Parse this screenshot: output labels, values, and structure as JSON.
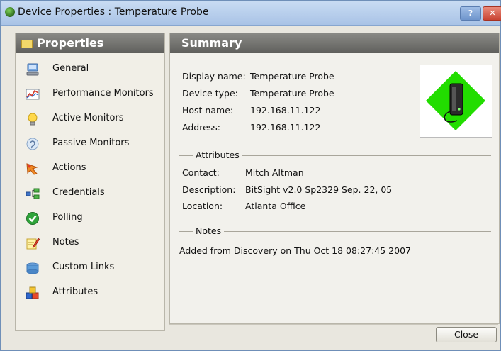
{
  "window": {
    "title": "Device Properties : Temperature Probe",
    "help_label": "?",
    "close_label": "✕"
  },
  "left_panel": {
    "header": "Properties",
    "items": [
      {
        "label": "General",
        "icon": "computer-icon"
      },
      {
        "label": "Performance Monitors",
        "icon": "chart-icon"
      },
      {
        "label": "Active Monitors",
        "icon": "lightbulb-icon"
      },
      {
        "label": "Passive Monitors",
        "icon": "ear-icon"
      },
      {
        "label": "Actions",
        "icon": "actions-icon"
      },
      {
        "label": "Credentials",
        "icon": "credentials-icon"
      },
      {
        "label": "Polling",
        "icon": "check-icon"
      },
      {
        "label": "Notes",
        "icon": "notes-icon"
      },
      {
        "label": "Custom Links",
        "icon": "custom-links-icon"
      },
      {
        "label": "Attributes",
        "icon": "attributes-icon"
      }
    ]
  },
  "summary": {
    "header": "Summary",
    "fields": {
      "display_name_label": "Display name:",
      "display_name": "Temperature Probe",
      "device_type_label": "Device type:",
      "device_type": "Temperature Probe",
      "host_name_label": "Host name:",
      "host_name": "192.168.11.122",
      "address_label": "Address:",
      "address": "192.168.11.122"
    },
    "attributes": {
      "title": "Attributes",
      "contact_label": "Contact:",
      "contact": "Mitch Altman",
      "description_label": "Description:",
      "description": "BitSight v2.0 Sp2329 Sep. 22, 05",
      "location_label": "Location:",
      "location": "Atlanta Office"
    },
    "notes": {
      "title": "Notes",
      "text": "Added from Discovery on Thu Oct 18 08:27:45 2007"
    }
  },
  "footer": {
    "close_button": "Close"
  },
  "colors": {
    "header_gray": "#6f6f6b",
    "device_diamond": "#22dd00",
    "title_bar": "#b9cfee"
  }
}
